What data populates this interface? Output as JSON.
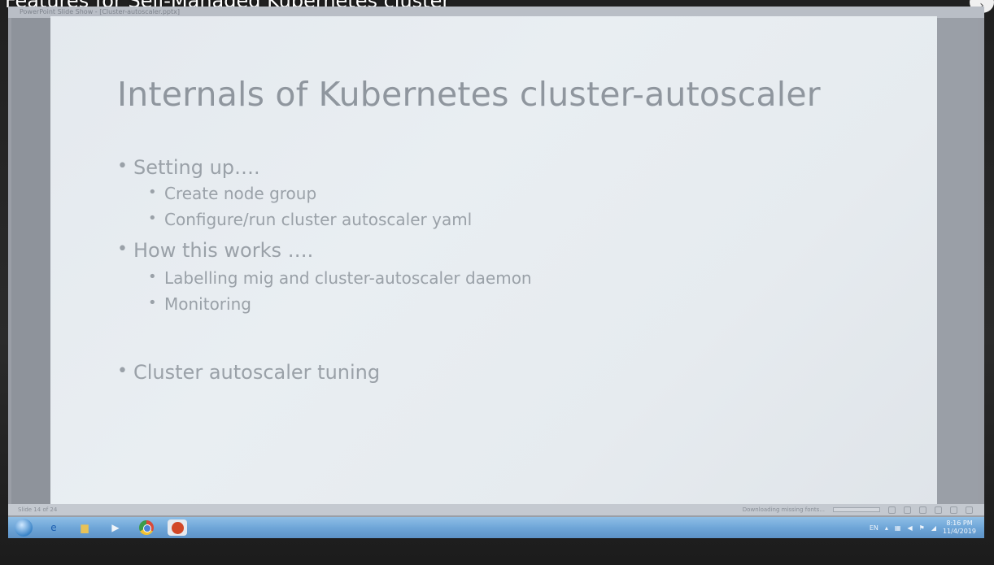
{
  "video": {
    "title": "Features for Self-Managed Kubernetes cluster",
    "corner_icon": "chevron-icon"
  },
  "app": {
    "titlebar_text": "PowerPoint Slide Show - [Cluster-autoscaler.pptx]"
  },
  "slide": {
    "title": "Internals of Kubernetes cluster-autoscaler",
    "bullets": [
      {
        "text": "Setting up….",
        "sub": [
          "Create node group",
          "Configure/run cluster autoscaler yaml"
        ]
      },
      {
        "text": "How this works ….",
        "sub": [
          "Labelling  mig and cluster-autoscaler daemon",
          "Monitoring"
        ]
      },
      {
        "text": "Cluster autoscaler tuning",
        "sub": []
      }
    ]
  },
  "status_bar": {
    "slide_counter": "Slide 14 of 24",
    "download_text": "Downloading missing fonts..."
  },
  "taskbar": {
    "language": "EN",
    "time": "8:16 PM",
    "date": "11/4/2019"
  },
  "colors": {
    "slide_bg": "#e6ebef",
    "slide_text": "#9aa1a8",
    "taskbar": "#6fa6d8"
  }
}
